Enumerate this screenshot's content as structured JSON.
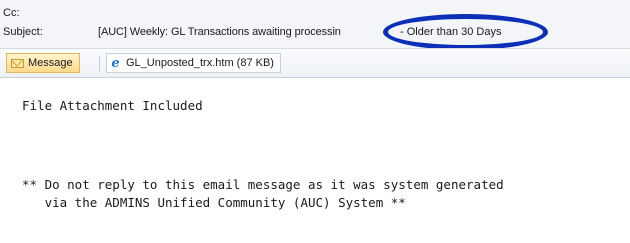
{
  "header": {
    "cc_label": "Cc:",
    "subject_label": "Subject:",
    "subject_text": "[AUC] Weekly: GL Transactions awaiting processin",
    "subject_highlight": "- Older than 30 Days",
    "highlight_color": "#0b2fb6"
  },
  "toolbar": {
    "message_tab": {
      "label": "Message",
      "icon": "envelope-icon"
    },
    "attachment": {
      "label": "GL_Unposted_trx.htm (87 KB)",
      "icon": "internet-explorer-icon"
    }
  },
  "body": {
    "line1": "File Attachment Included",
    "line2": "** Do not reply to this email message as it was system generated",
    "line3": "   via the ADMINS Unified Community (AUC) System **"
  }
}
